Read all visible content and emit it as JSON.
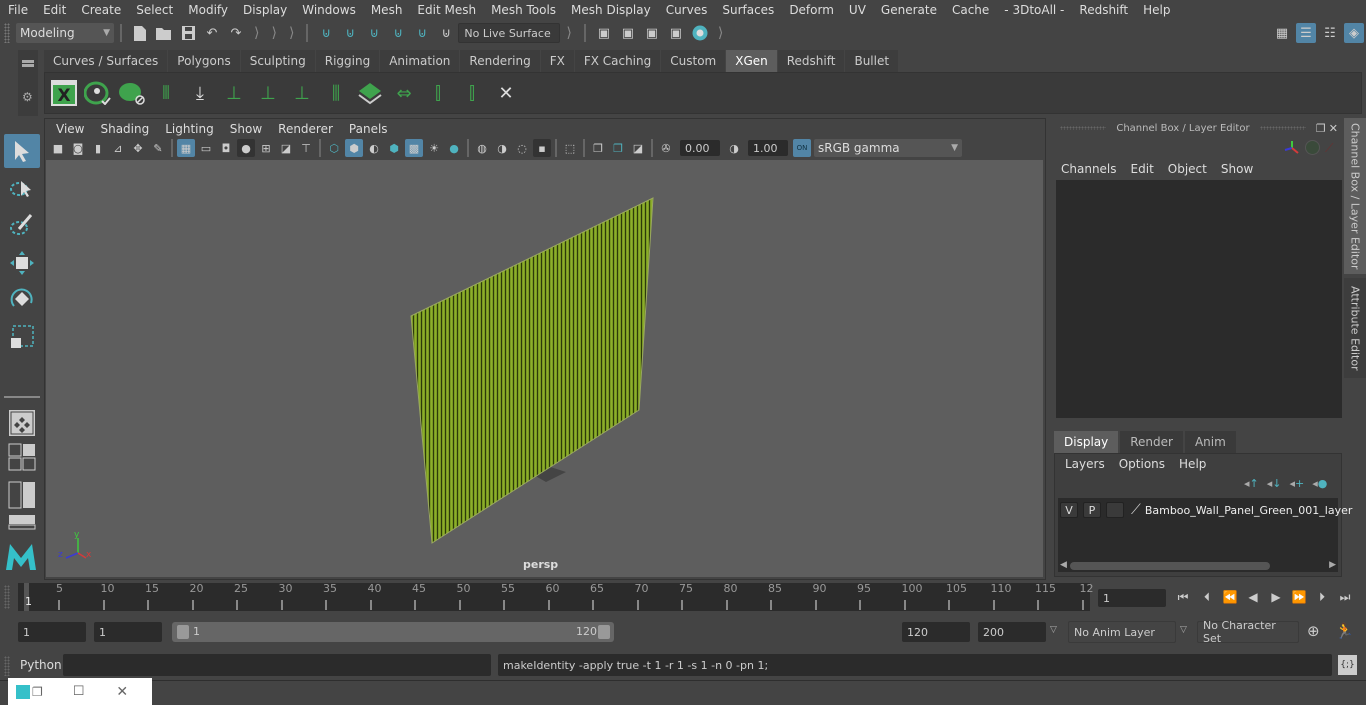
{
  "menubar": {
    "items": [
      "File",
      "Edit",
      "Create",
      "Select",
      "Modify",
      "Display",
      "Windows",
      "Mesh",
      "Edit Mesh",
      "Mesh Tools",
      "Mesh Display",
      "Curves",
      "Surfaces",
      "Deform",
      "UV",
      "Generate",
      "Cache",
      "- 3DtoAll -",
      "Redshift",
      "Help"
    ]
  },
  "statusline": {
    "mode": "Modeling",
    "live_surface": "No Live Surface"
  },
  "shelf": {
    "tabs": [
      "Curves / Surfaces",
      "Polygons",
      "Sculpting",
      "Rigging",
      "Animation",
      "Rendering",
      "FX",
      "FX Caching",
      "Custom",
      "XGen",
      "Redshift",
      "Bullet"
    ],
    "active_tab": "XGen",
    "icons": [
      "xgen-editor-icon",
      "preview-visible-icon",
      "hide-preview-icon",
      "add-guides-icon",
      "place-guides-icon",
      "add-guide-icon",
      "show-guides-icon",
      "lock-guides-icon",
      "split-guides-icon",
      "guide-mesh-icon",
      "flip-guides-icon",
      "select-guides-icon",
      "guide-frame-icon",
      "delete-guides-icon"
    ]
  },
  "panel": {
    "menu": [
      "View",
      "Shading",
      "Lighting",
      "Show",
      "Renderer",
      "Panels"
    ],
    "exposure": "0.00",
    "gamma": "1.00",
    "color_space": "sRGB gamma",
    "camera_label": "persp",
    "axis_labels": {
      "x": "x",
      "y": "y",
      "z": "z"
    }
  },
  "channelbox": {
    "title": "Channel Box / Layer Editor",
    "menu": [
      "Channels",
      "Edit",
      "Object",
      "Show"
    ]
  },
  "layer_editor": {
    "tabs": [
      "Display",
      "Render",
      "Anim"
    ],
    "active_tab": "Display",
    "menu": [
      "Layers",
      "Options",
      "Help"
    ],
    "layers": [
      {
        "visible": "V",
        "playback": "P",
        "name": "Bamboo_Wall_Panel_Green_001_layer"
      }
    ]
  },
  "side_tabs": [
    "Channel Box / Layer Editor",
    "Attribute Editor"
  ],
  "timeline": {
    "ticks": [
      "5",
      "10",
      "15",
      "20",
      "25",
      "30",
      "35",
      "40",
      "45",
      "50",
      "55",
      "60",
      "65",
      "70",
      "75",
      "80",
      "85",
      "90",
      "95",
      "100",
      "105",
      "110",
      "115",
      "12"
    ],
    "current_frame_marker": "1",
    "current_frame": "1"
  },
  "range": {
    "start_time": "1",
    "playback_start": "1",
    "slider_start": "1",
    "slider_end": "120",
    "playback_end": "120",
    "end_time": "200",
    "anim_layer": "No Anim Layer",
    "character_set": "No Character Set"
  },
  "commandline": {
    "language": "Python",
    "input": "",
    "output": "makeIdentity -apply true -t 1 -r 1 -s 1 -n 0 -pn 1;"
  }
}
